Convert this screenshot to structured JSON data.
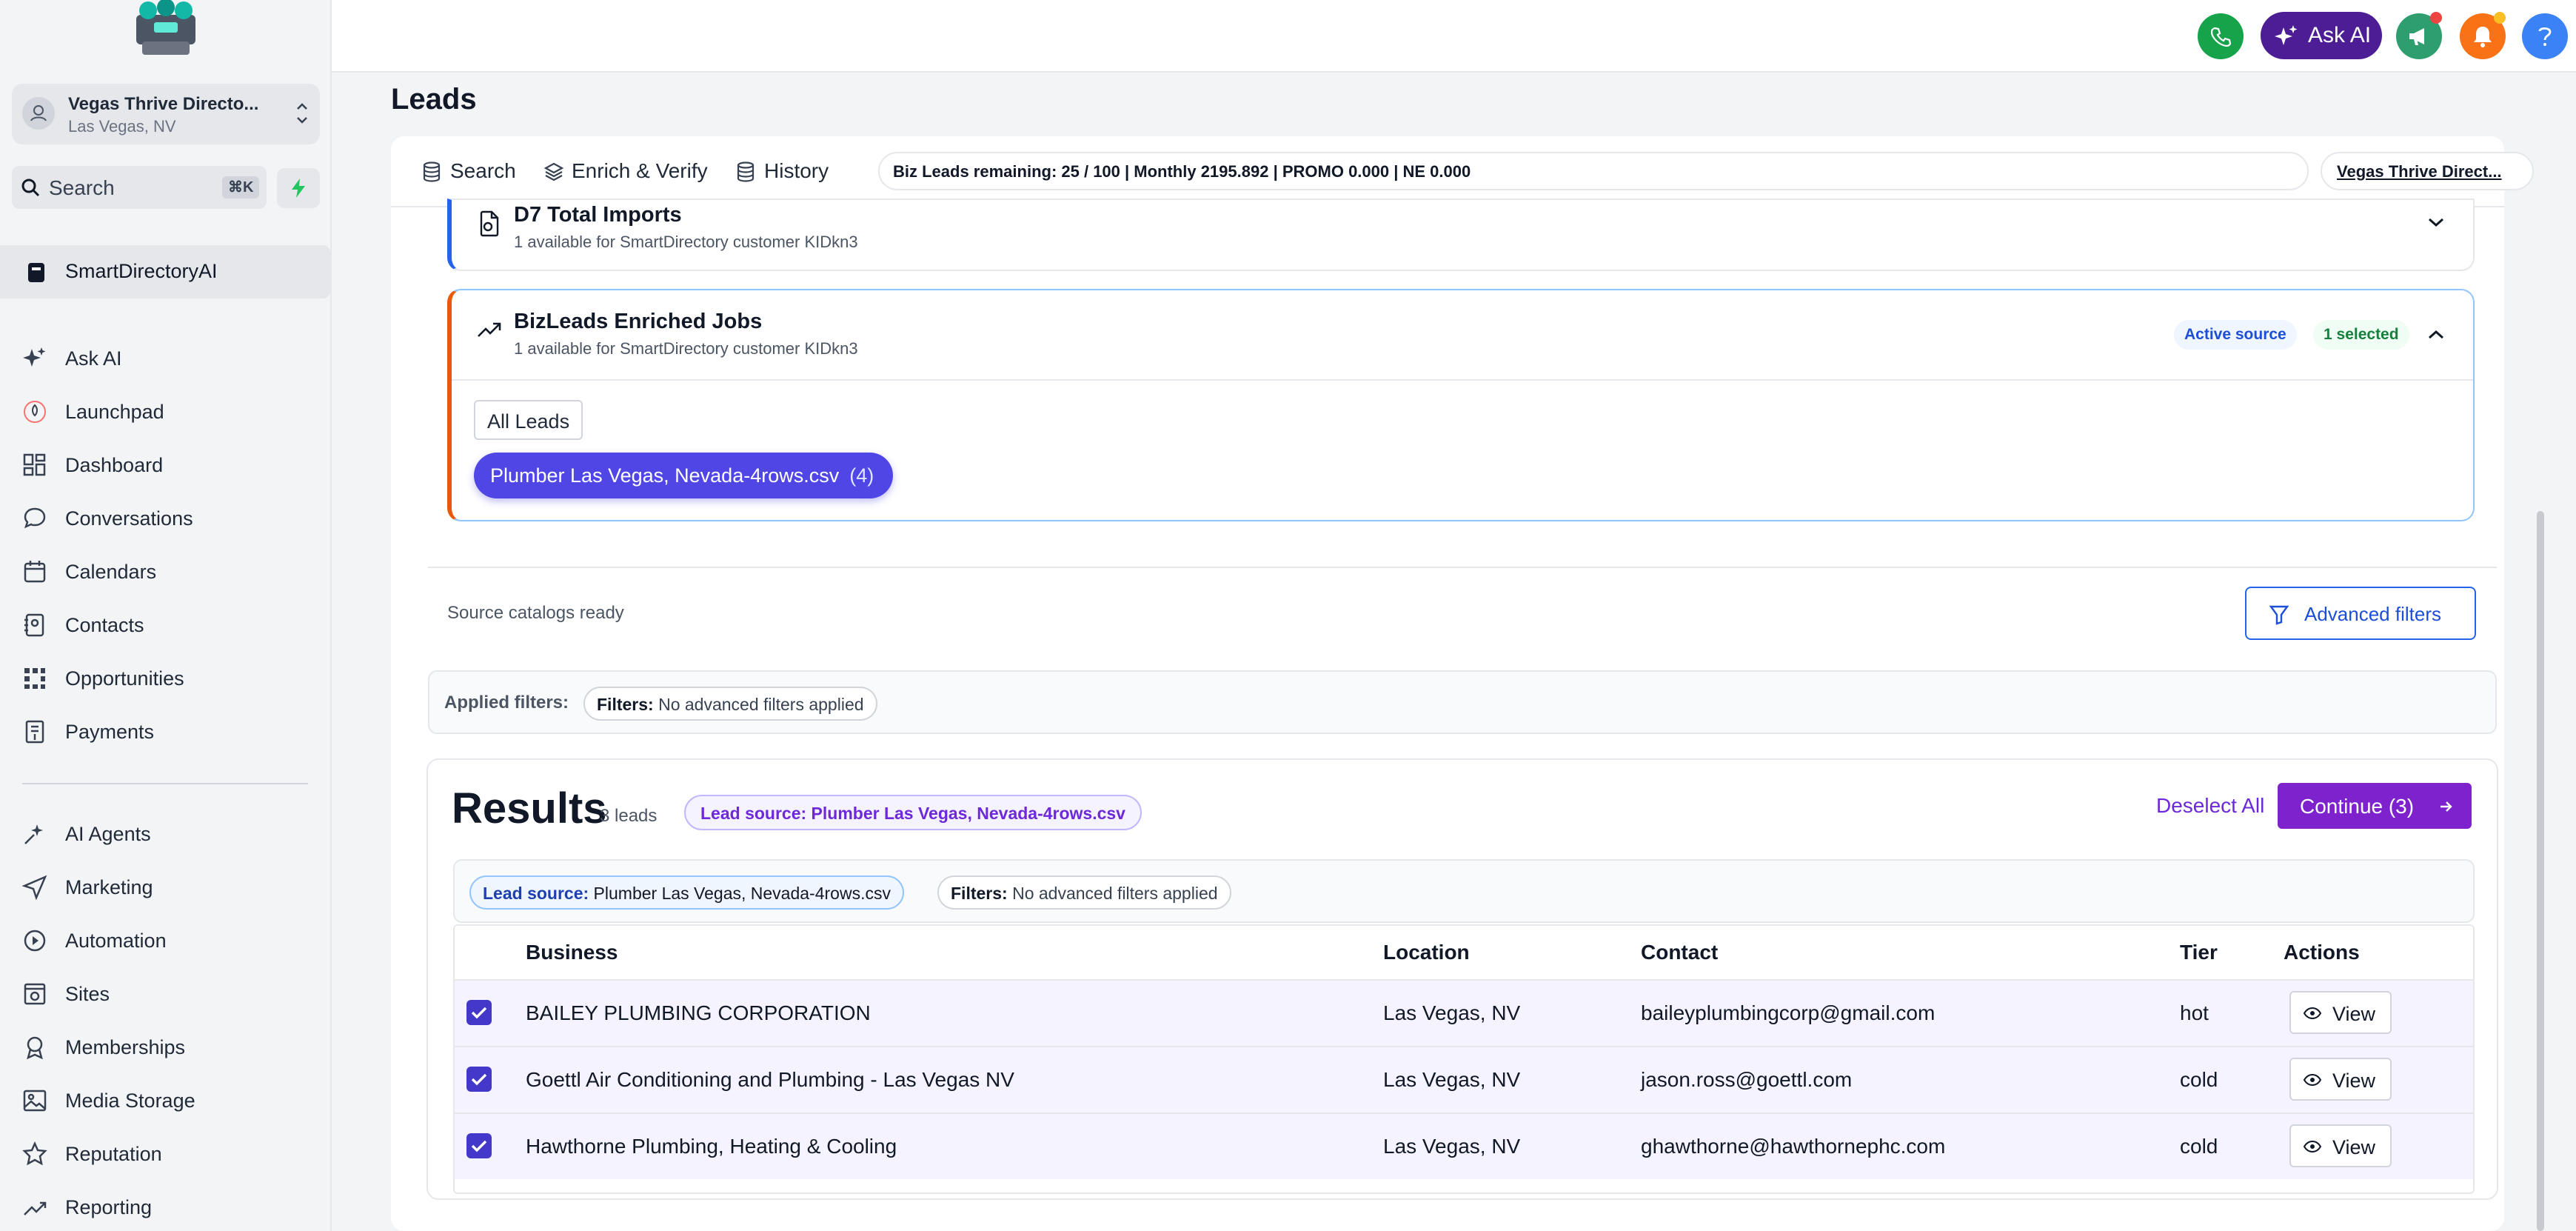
{
  "sidebar": {
    "account": {
      "name": "Vegas Thrive Directo...",
      "location": "Las Vegas, NV"
    },
    "search": {
      "label": "Search",
      "shortcut": "⌘K"
    },
    "active_app": "SmartDirectoryAI",
    "items": [
      {
        "label": "Ask AI",
        "icon": "sparkle-icon"
      },
      {
        "label": "Launchpad",
        "icon": "rocket-icon"
      },
      {
        "label": "Dashboard",
        "icon": "dashboard-icon"
      },
      {
        "label": "Conversations",
        "icon": "chat-icon"
      },
      {
        "label": "Calendars",
        "icon": "calendar-icon"
      },
      {
        "label": "Contacts",
        "icon": "contacts-icon"
      },
      {
        "label": "Opportunities",
        "icon": "opportunities-icon"
      },
      {
        "label": "Payments",
        "icon": "payments-icon"
      }
    ],
    "items2": [
      {
        "label": "AI Agents",
        "icon": "ai-agents-icon"
      },
      {
        "label": "Marketing",
        "icon": "send-icon"
      },
      {
        "label": "Automation",
        "icon": "automation-icon"
      },
      {
        "label": "Sites",
        "icon": "sites-icon"
      },
      {
        "label": "Memberships",
        "icon": "badge-icon"
      },
      {
        "label": "Media Storage",
        "icon": "image-icon"
      },
      {
        "label": "Reputation",
        "icon": "star-icon"
      },
      {
        "label": "Reporting",
        "icon": "trend-icon"
      }
    ]
  },
  "topbar": {
    "ask_ai_label": "Ask AI",
    "colors": {
      "phone": "#16a34a",
      "ask_ai": "#4c1d95",
      "announce": "#2f9e6e",
      "bell": "#f97316",
      "help": "#3b82f6"
    }
  },
  "page": {
    "title": "Leads",
    "tabs": [
      {
        "label": "Search",
        "icon": "database-icon"
      },
      {
        "label": "Enrich & Verify",
        "icon": "layers-icon"
      },
      {
        "label": "History",
        "icon": "database-icon"
      }
    ],
    "quota": "Biz Leads remaining: 25 / 100 | Monthly 2195.892 | PROMO 0.000 | NE 0.000",
    "account_chip": "Vegas Thrive Direct..."
  },
  "sources": [
    {
      "title": "D7 Total Imports",
      "subtitle": "1 available for SmartDirectory customer KIDkn3"
    },
    {
      "title": "BizLeads Enriched Jobs",
      "subtitle": "1 available for SmartDirectory customer KIDkn3",
      "badge_active": "Active source",
      "badge_selected": "1 selected",
      "all_leads": "All Leads",
      "file": "Plumber Las Vegas, Nevada-4rows.csv",
      "file_count": "(4)"
    }
  ],
  "catalog_status": "Source catalogs ready",
  "advanced_filters_label": "Advanced filters",
  "applied_filters": {
    "label": "Applied filters:",
    "key": "Filters:",
    "value": "No advanced filters applied"
  },
  "results": {
    "title": "Results",
    "count": "3 leads",
    "source_chip": "Lead source: Plumber Las Vegas, Nevada-4rows.csv",
    "deselect": "Deselect All",
    "continue": "Continue (3)",
    "chip_source_key": "Lead source:",
    "chip_source_value": "Plumber Las Vegas, Nevada-4rows.csv",
    "chip_filters_key": "Filters:",
    "chip_filters_value": "No advanced filters applied",
    "columns": [
      "Business",
      "Location",
      "Contact",
      "Tier",
      "Actions"
    ],
    "rows": [
      {
        "business": "BAILEY PLUMBING CORPORATION",
        "location": "Las Vegas, NV",
        "contact": "baileyplumbingcorp@gmail.com",
        "tier": "hot",
        "action": "View",
        "checked": true
      },
      {
        "business": "Goettl Air Conditioning and Plumbing - Las Vegas NV",
        "location": "Las Vegas, NV",
        "contact": "jason.ross@goettl.com",
        "tier": "cold",
        "action": "View",
        "checked": true
      },
      {
        "business": "Hawthorne Plumbing, Heating & Cooling",
        "location": "Las Vegas, NV",
        "contact": "ghawthorne@hawthornephc.com",
        "tier": "cold",
        "action": "View",
        "checked": true
      }
    ]
  }
}
